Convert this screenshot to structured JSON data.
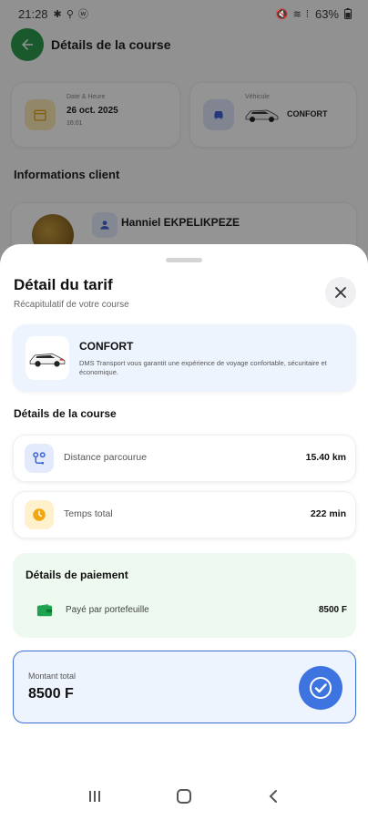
{
  "status_bar": {
    "time": "21:28",
    "left_icons": "✱ ⚲ ⓦ",
    "right_icons": "🔇 ≋ ⏅ 63%",
    "battery": "63%"
  },
  "background": {
    "title": "Détails de la course",
    "date_card": {
      "label": "Date & Heure",
      "date": "26 oct. 2025",
      "time": "16:01"
    },
    "vehicle_card": {
      "label": "Véhicule",
      "name": "CONFORT"
    },
    "section_title": "Informations client",
    "client_name": "Hanniel EKPELIKPEZE"
  },
  "sheet": {
    "title": "Détail du tarif",
    "subtitle": "Récapitulatif de votre course",
    "vehicle": {
      "name": "CONFORT",
      "description": "DMS Transport vous garantit une expérience de voyage confortable, sécuritaire et économique."
    },
    "course_section_title": "Détails de la course",
    "distance": {
      "label": "Distance parcourue",
      "value": "15.40 km"
    },
    "duration": {
      "label": "Temps total",
      "value": "222 min"
    },
    "payment": {
      "title": "Détails de paiement",
      "label": "Payé par portefeuille",
      "value": "8500 F"
    },
    "total": {
      "label": "Montant total",
      "value": "8500 F"
    }
  },
  "colors": {
    "primary_blue": "#3d74e0",
    "green_back": "#2e9a4a",
    "payment_bg": "#eefaf0",
    "card_blue_bg": "#eef4fe"
  }
}
